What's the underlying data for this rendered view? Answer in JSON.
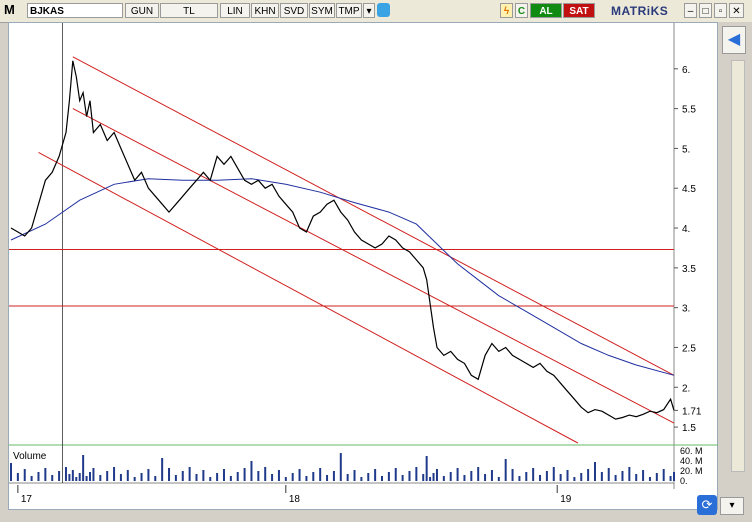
{
  "toolbar": {
    "logo": "M",
    "symbol": "BJKAS",
    "buttons": [
      "GUN",
      "TL",
      "LIN",
      "KHN",
      "SVD",
      "SYM",
      "TMP"
    ],
    "al_label": "AL",
    "sat_label": "SAT",
    "brand": "MATRiKS",
    "c_label": "C"
  },
  "chart_data": {
    "type": "line",
    "symbol": "BJKAS",
    "y_ticks": [
      "6.",
      "5.5",
      "5.",
      "4.5",
      "4.",
      "3.5",
      "3.",
      "2.5",
      "2.",
      "1.71",
      "1.5"
    ],
    "y_tick_values": [
      6,
      5.5,
      5,
      4.5,
      4,
      3.5,
      3,
      2.5,
      2,
      1.71,
      1.5
    ],
    "ylim": [
      1.3,
      6.5
    ],
    "x_ticks": [
      "17",
      "18",
      "19"
    ],
    "last_value": "1.71",
    "horizontal_lines": [
      3.73,
      3.02
    ],
    "price_series": [
      [
        0,
        4.0
      ],
      [
        4,
        3.95
      ],
      [
        8,
        3.9
      ],
      [
        12,
        4.0
      ],
      [
        16,
        4.3
      ],
      [
        20,
        4.6
      ],
      [
        24,
        4.7
      ],
      [
        28,
        4.9
      ],
      [
        32,
        5.2
      ],
      [
        34,
        5.6
      ],
      [
        36,
        6.1
      ],
      [
        38,
        5.9
      ],
      [
        40,
        5.6
      ],
      [
        42,
        5.7
      ],
      [
        44,
        5.4
      ],
      [
        46,
        5.6
      ],
      [
        48,
        5.2
      ],
      [
        52,
        5.3
      ],
      [
        56,
        5.1
      ],
      [
        60,
        5.2
      ],
      [
        64,
        5.0
      ],
      [
        68,
        4.8
      ],
      [
        72,
        4.6
      ],
      [
        76,
        4.7
      ],
      [
        80,
        4.5
      ],
      [
        84,
        4.4
      ],
      [
        88,
        4.3
      ],
      [
        92,
        4.2
      ],
      [
        96,
        4.3
      ],
      [
        100,
        4.4
      ],
      [
        104,
        4.5
      ],
      [
        108,
        4.6
      ],
      [
        112,
        4.7
      ],
      [
        116,
        4.6
      ],
      [
        120,
        4.9
      ],
      [
        124,
        4.8
      ],
      [
        128,
        4.9
      ],
      [
        132,
        4.75
      ],
      [
        136,
        4.6
      ],
      [
        140,
        4.55
      ],
      [
        144,
        4.6
      ],
      [
        148,
        4.5
      ],
      [
        152,
        4.55
      ],
      [
        156,
        4.4
      ],
      [
        160,
        4.3
      ],
      [
        164,
        4.2
      ],
      [
        168,
        4.0
      ],
      [
        172,
        3.95
      ],
      [
        176,
        4.15
      ],
      [
        180,
        4.2
      ],
      [
        184,
        4.3
      ],
      [
        188,
        4.35
      ],
      [
        192,
        4.2
      ],
      [
        196,
        4.1
      ],
      [
        200,
        3.95
      ],
      [
        204,
        3.85
      ],
      [
        208,
        3.8
      ],
      [
        212,
        3.75
      ],
      [
        216,
        3.8
      ],
      [
        220,
        3.9
      ],
      [
        224,
        3.85
      ],
      [
        228,
        3.75
      ],
      [
        232,
        3.7
      ],
      [
        236,
        3.6
      ],
      [
        240,
        3.5
      ],
      [
        242,
        3.35
      ],
      [
        244,
        3.05
      ],
      [
        246,
        2.75
      ],
      [
        248,
        2.5
      ],
      [
        252,
        2.4
      ],
      [
        256,
        2.45
      ],
      [
        260,
        2.35
      ],
      [
        264,
        2.3
      ],
      [
        268,
        2.15
      ],
      [
        272,
        2.1
      ],
      [
        276,
        2.4
      ],
      [
        280,
        2.55
      ],
      [
        284,
        2.45
      ],
      [
        288,
        2.5
      ],
      [
        292,
        2.4
      ],
      [
        296,
        2.35
      ],
      [
        300,
        2.3
      ],
      [
        304,
        2.25
      ],
      [
        308,
        2.3
      ],
      [
        312,
        2.2
      ],
      [
        316,
        2.15
      ],
      [
        320,
        2.05
      ],
      [
        324,
        1.95
      ],
      [
        328,
        1.85
      ],
      [
        332,
        1.75
      ],
      [
        336,
        1.68
      ],
      [
        340,
        1.72
      ],
      [
        344,
        1.7
      ],
      [
        348,
        1.65
      ],
      [
        352,
        1.6
      ],
      [
        356,
        1.62
      ],
      [
        360,
        1.65
      ],
      [
        364,
        1.63
      ],
      [
        368,
        1.66
      ],
      [
        372,
        1.7
      ],
      [
        376,
        1.68
      ],
      [
        380,
        1.72
      ],
      [
        384,
        1.85
      ],
      [
        386,
        1.71
      ]
    ],
    "ma_series": [
      [
        0,
        3.85
      ],
      [
        20,
        4.05
      ],
      [
        40,
        4.35
      ],
      [
        60,
        4.55
      ],
      [
        80,
        4.62
      ],
      [
        100,
        4.6
      ],
      [
        120,
        4.6
      ],
      [
        140,
        4.62
      ],
      [
        160,
        4.55
      ],
      [
        180,
        4.45
      ],
      [
        200,
        4.32
      ],
      [
        220,
        4.2
      ],
      [
        236,
        4.05
      ],
      [
        248,
        3.8
      ],
      [
        260,
        3.55
      ],
      [
        272,
        3.35
      ],
      [
        284,
        3.15
      ],
      [
        300,
        2.95
      ],
      [
        316,
        2.75
      ],
      [
        332,
        2.55
      ],
      [
        348,
        2.4
      ],
      [
        364,
        2.28
      ],
      [
        386,
        2.15
      ]
    ],
    "channel_lines": [
      [
        [
          36,
          6.15
        ],
        [
          386,
          2.15
        ]
      ],
      [
        [
          36,
          5.5
        ],
        [
          386,
          1.55
        ]
      ],
      [
        [
          16,
          4.95
        ],
        [
          330,
          1.3
        ]
      ]
    ],
    "volume": {
      "label": "Volume",
      "ticks": [
        "60. M",
        "40. M",
        "20. M",
        "0."
      ]
    }
  }
}
